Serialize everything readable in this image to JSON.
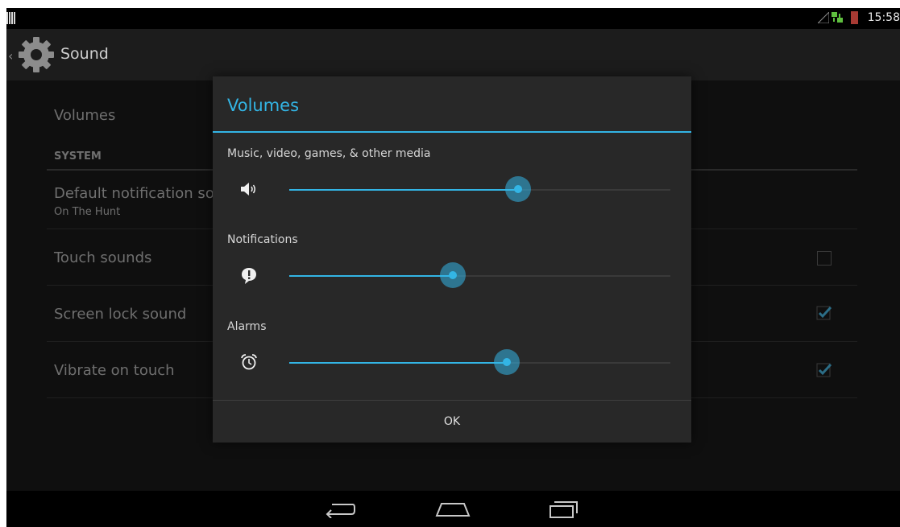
{
  "status_bar": {
    "time": "15:58",
    "battery_color": "#a73a33"
  },
  "action_bar": {
    "title": "Sound",
    "up_glyph": "‹",
    "icon": "settings-gear-icon"
  },
  "settings": {
    "volumes_label": "Volumes",
    "section_system": "SYSTEM",
    "default_notification": {
      "title": "Default notification sou",
      "summary": "On The Hunt"
    },
    "touch_sounds": {
      "title": "Touch sounds",
      "checked": false
    },
    "screen_lock_sound": {
      "title": "Screen lock sound",
      "checked": true
    },
    "vibrate_on_touch": {
      "title": "Vibrate on touch",
      "checked": true
    }
  },
  "dialog": {
    "title": "Volumes",
    "sliders": [
      {
        "label": "Music, video, games, & other media",
        "icon": "speaker-icon",
        "level_fraction": 0.6
      },
      {
        "label": "Notifications",
        "icon": "notification-bubble-icon",
        "level_fraction": 0.43
      },
      {
        "label": "Alarms",
        "icon": "alarm-clock-icon",
        "level_fraction": 0.57
      }
    ],
    "ok_label": "OK"
  },
  "navigation": {
    "back": "back-icon",
    "home": "home-icon",
    "recents": "recents-icon"
  },
  "colors": {
    "accent": "#33b5e5",
    "background": "#0f0f0f",
    "dialog_bg": "#282828"
  }
}
